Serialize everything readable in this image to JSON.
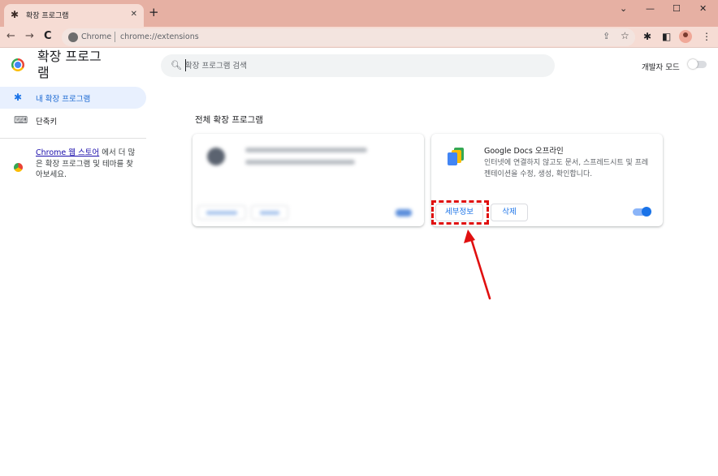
{
  "browser": {
    "tab_title": "확장 프로그램",
    "tab_icon": "puzzle-icon",
    "omnibox_site_label": "Chrome",
    "omnibox_url": "chrome://extensions"
  },
  "header": {
    "title": "확장 프로그램",
    "search_placeholder": "확장 프로그램 검색",
    "dev_mode_label": "개발자 모드",
    "dev_mode_on": false
  },
  "sidebar": {
    "items": [
      {
        "label": "내 확장 프로그램",
        "icon": "puzzle-icon",
        "active": true
      },
      {
        "label": "단축키",
        "icon": "keyboard-icon",
        "active": false
      }
    ],
    "store_link_text": "Chrome 웹 스토어",
    "store_text_after": "에서 더 많은 확장 프로그램 및 테마를 찾아보세요."
  },
  "main": {
    "section_title": "전체 확장 프로그램",
    "extensions": [
      {
        "name": "Google Docs 오프라인",
        "description": "인터넷에 연결하지 않고도 문서, 스프레드시트 및 프레젠테이션을 수정, 생성, 확인합니다.",
        "details_label": "세부정보",
        "remove_label": "삭제",
        "enabled": true
      }
    ]
  },
  "colors": {
    "accent": "#1a73e8",
    "annotation": "#e01010",
    "titlebar": "#e6b0a3",
    "toolbar": "#f6dcd4"
  }
}
